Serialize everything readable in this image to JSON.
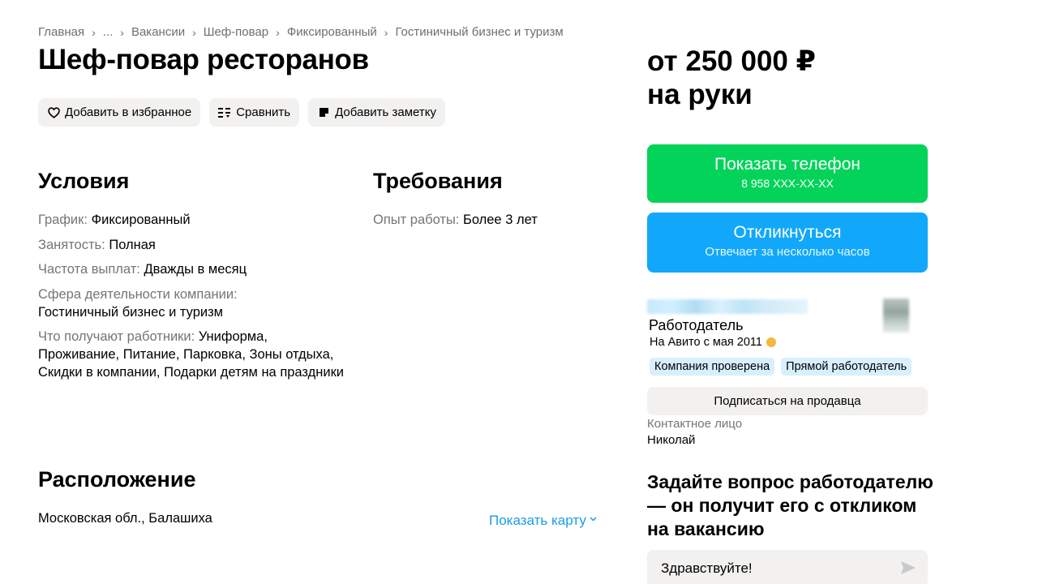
{
  "breadcrumb": {
    "items": [
      "Главная",
      "...",
      "Вакансии",
      "Шеф-повар",
      "Фиксированный",
      "Гостиничный бизнес и туризм"
    ],
    "separator": "›"
  },
  "title": "Шеф-повар ресторанов",
  "actions": {
    "favorite_label": "Добавить в избранное",
    "compare_label": "Сравнить",
    "note_label": "Добавить заметку"
  },
  "conditions": {
    "title": "Условия",
    "items": [
      {
        "key": "График:",
        "value": "Фиксированный"
      },
      {
        "key": "Занятость:",
        "value": "Полная"
      },
      {
        "key": "Частота выплат:",
        "value": "Дважды в месяц"
      },
      {
        "key": "Сфера деятельности компании:",
        "value": "Гостиничный бизнес и туризм"
      },
      {
        "key": "Что получают работники:",
        "value": "Униформа, Проживание, Питание, Парковка, Зоны отдыха, Скидки в компании, Подарки детям на праздники"
      }
    ]
  },
  "requirements": {
    "title": "Требования",
    "items": [
      {
        "key": "Опыт работы:",
        "value": "Более 3 лет"
      }
    ]
  },
  "location": {
    "title": "Расположение",
    "address": "Московская обл., Балашиха",
    "show_map_label": "Показать карту"
  },
  "salary": {
    "line1": "от 250 000 ₽",
    "line2": "на руки"
  },
  "phone_button": {
    "label": "Показать телефон",
    "number": "8 958 XXX-XX-XX"
  },
  "reply_button": {
    "label": "Откликнуться",
    "sub": "Отвечает за несколько часов"
  },
  "employer": {
    "label": "Работодатель",
    "since": "На Авито с мая 2011",
    "badges": [
      "Компания проверена",
      "Прямой работодатель"
    ],
    "subscribe_label": "Подписаться на продавца",
    "contact_label": "Контактное лицо",
    "contact_name": "Николай"
  },
  "question": {
    "title": "Задайте вопрос работодателю — он получит его с откликом на вакансию",
    "message_value": "Здравствуйте!"
  },
  "colors": {
    "green_button": "#04d35a",
    "blue_button": "#11a8fb",
    "link": "#1a9de6",
    "badge_bg": "#d8effd"
  }
}
